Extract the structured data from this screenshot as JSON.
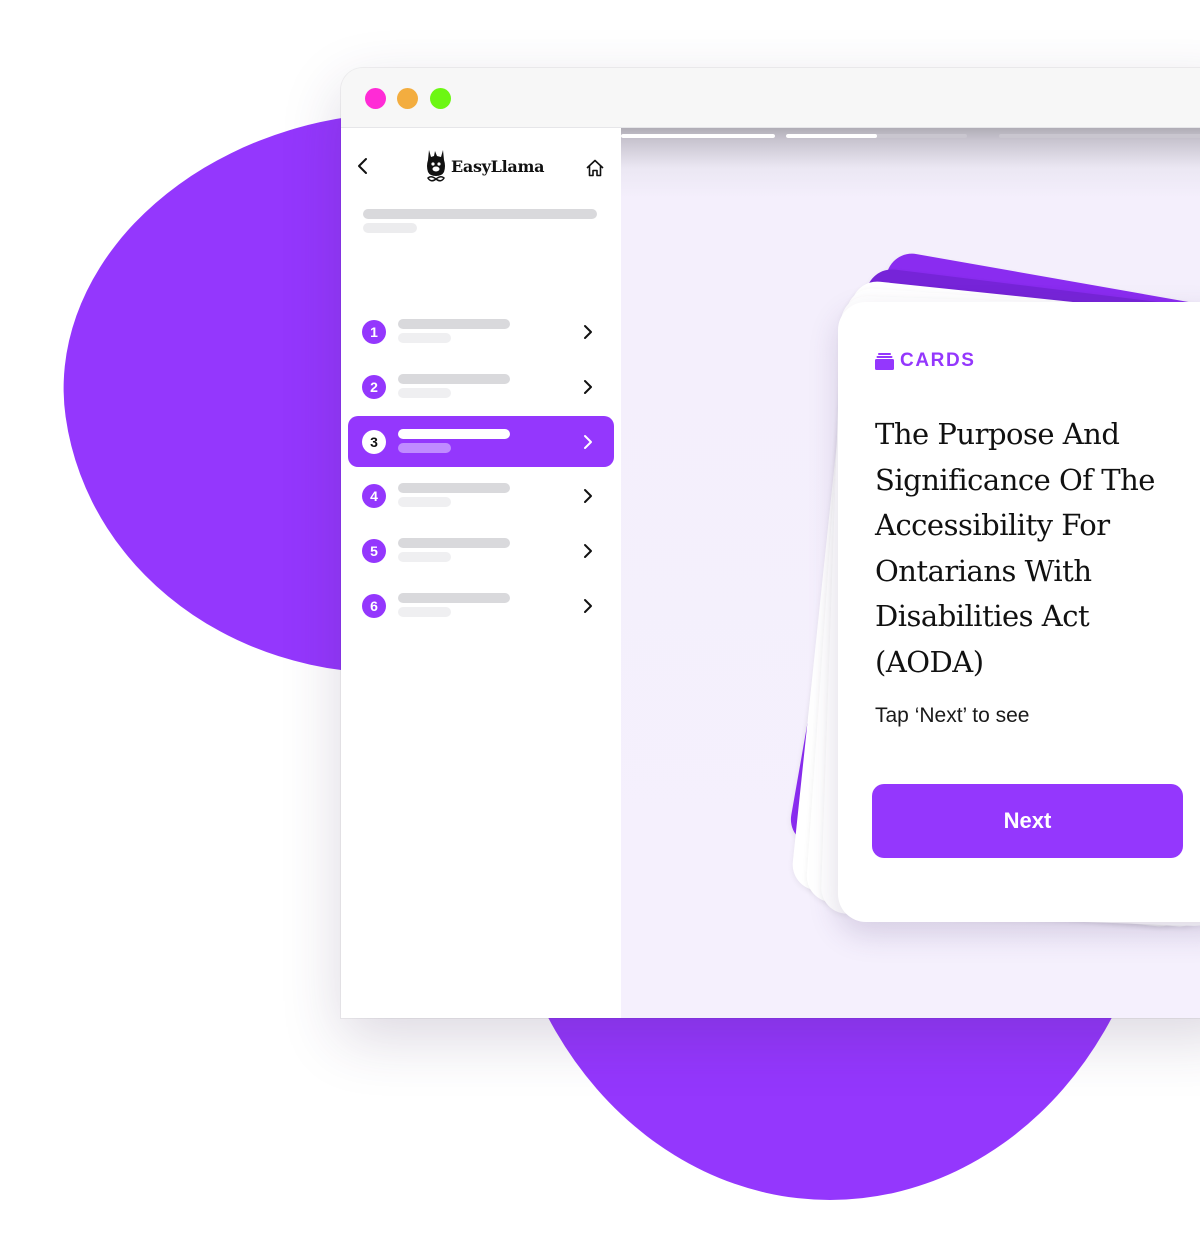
{
  "window": {
    "traffic_lights": [
      {
        "name": "close",
        "color": "#ff2bd6"
      },
      {
        "name": "minimize",
        "color": "#f3ad3f"
      },
      {
        "name": "maximize",
        "color": "#6cf713"
      }
    ]
  },
  "brand": {
    "name": "EasyLlama",
    "accent": "#9437fd"
  },
  "sidebar": {
    "back_icon": "chevron-left-icon",
    "home_icon": "home-icon",
    "lessons": [
      {
        "number": "1",
        "active": false
      },
      {
        "number": "2",
        "active": false
      },
      {
        "number": "3",
        "active": true
      },
      {
        "number": "4",
        "active": false
      },
      {
        "number": "5",
        "active": false
      },
      {
        "number": "6",
        "active": false
      }
    ]
  },
  "progress": {
    "segments": [
      1.0,
      0.5,
      0.0,
      0.0
    ]
  },
  "card": {
    "tag_icon": "cards-stack-icon",
    "tag": "CARDS",
    "title": "The Purpose And Significance Of The Accessibility For Ontarians With Disabilities Act (AODA)",
    "hint": "Tap ‘Next’ to see",
    "next_label": "Next"
  }
}
